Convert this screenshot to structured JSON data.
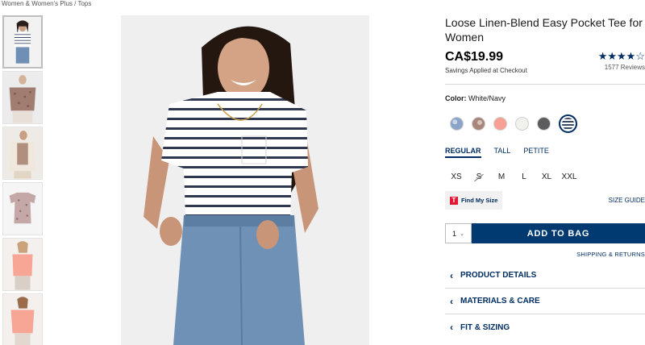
{
  "breadcrumb": {
    "text": "Women & Women's Plus / Tops"
  },
  "product": {
    "title": "Loose Linen-Blend Easy Pocket Tee for Women",
    "price": "CA$19.99",
    "savings": "Savings Applied at Checkout",
    "rating_stars": "★★★★☆",
    "rating_value": 4.5,
    "reviews": "1577 Reviews"
  },
  "color": {
    "label": "Color:",
    "selected": "White/Navy",
    "swatches": [
      {
        "name": "blue-floral",
        "color": "#8aa4c8"
      },
      {
        "name": "brown-floral",
        "color": "#a8877a"
      },
      {
        "name": "coral",
        "color": "#f7a093"
      },
      {
        "name": "white",
        "color": "#f1f1ee"
      },
      {
        "name": "charcoal",
        "color": "#5c5c5e"
      },
      {
        "name": "white-navy-stripe",
        "color": "#3b4a66"
      }
    ]
  },
  "fit_tabs": [
    "REGULAR",
    "TALL",
    "PETITE"
  ],
  "sizes": [
    "XS",
    "S",
    "M",
    "L",
    "XL",
    "XXL"
  ],
  "find_my_size": "Find My Size",
  "size_guide": "SIZE GUIDE",
  "quantity": "1",
  "add_to_bag": "ADD TO BAG",
  "shipping_returns": "SHIPPING & RETURNS",
  "accordion": [
    "PRODUCT DETAILS",
    "MATERIALS & CARE",
    "FIT & SIZING"
  ],
  "icons": {
    "chevron": "chevron-left-icon",
    "dropdown": "chevron-down-icon"
  }
}
